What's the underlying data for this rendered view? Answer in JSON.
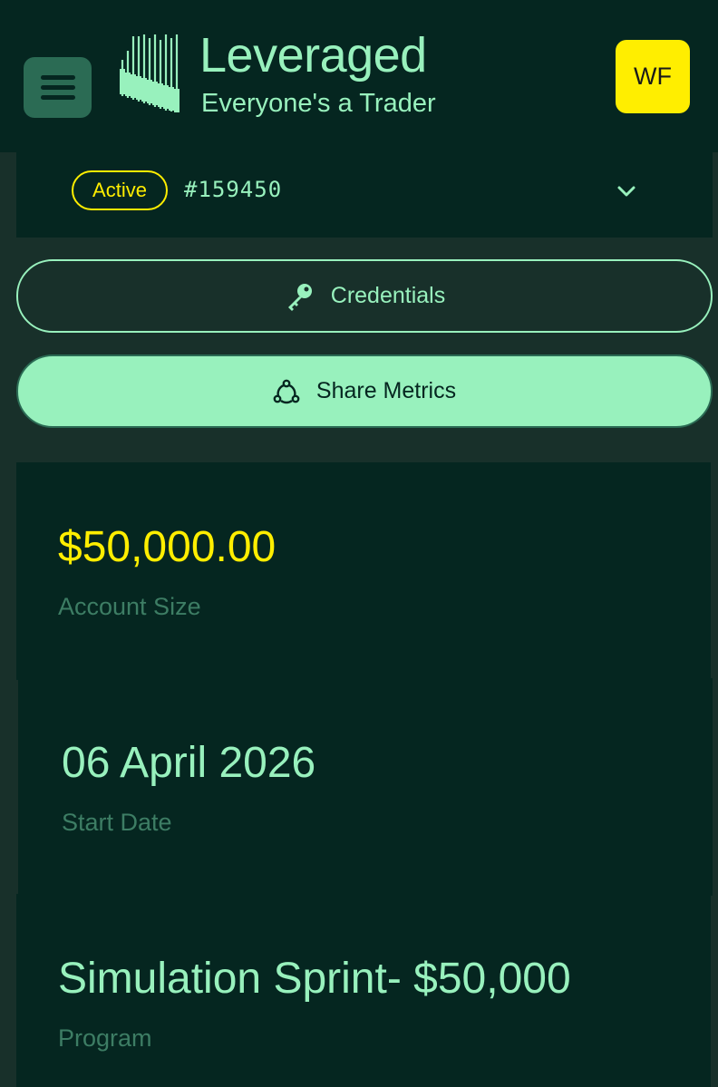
{
  "header": {
    "brand_name": "Leveraged",
    "tagline": "Everyone's a Trader",
    "user_initials": "WF",
    "menu_icon": "hamburger-menu-icon"
  },
  "account": {
    "status": "Active",
    "id": "#159450",
    "expand_icon": "chevron-down-icon"
  },
  "actions": {
    "credentials_label": "Credentials",
    "credentials_icon": "key-icon",
    "share_label": "Share Metrics",
    "share_icon": "share-network-icon"
  },
  "stats": [
    {
      "value": "$50,000.00",
      "label": "Account Size"
    },
    {
      "value": "06 April 2026",
      "label": "Start Date"
    },
    {
      "value": "Simulation Sprint- $50,000",
      "label": "Program"
    }
  ],
  "colors": {
    "background": "#18302a",
    "panel": "#052620",
    "accent_mint": "#98f1bd",
    "accent_yellow": "#ffee00",
    "muted_label": "#3d7d64"
  }
}
